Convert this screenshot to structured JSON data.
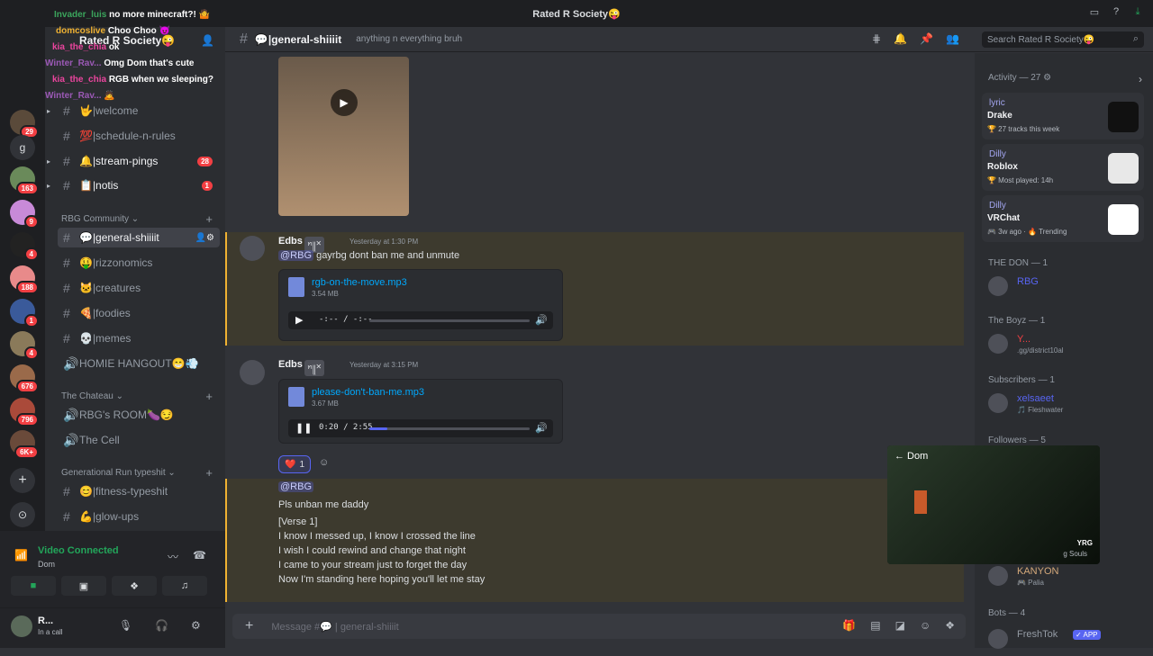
{
  "window": {
    "title": "Rated R Society😜"
  },
  "server": {
    "name": "Rated R Society😜"
  },
  "guild_badges": [
    "29",
    "163",
    "9",
    "4",
    "188",
    "1",
    "4",
    "676",
    "796",
    "6K+"
  ],
  "channels": [
    {
      "name": "🤟|welcome",
      "badge": ""
    },
    {
      "name": "💯|schedule-n-rules",
      "badge": ""
    },
    {
      "name": "🔔|stream-pings",
      "badge": "28"
    },
    {
      "name": "📋|notis",
      "badge": "1"
    }
  ],
  "category_rbg": "RBG Community",
  "channels_rbg": [
    {
      "name": "💬|general-shiiiit",
      "active": true
    },
    {
      "name": "🤑|rizzonomics"
    },
    {
      "name": "🐱|creatures"
    },
    {
      "name": "🍕|foodies"
    },
    {
      "name": "💀|memes"
    },
    {
      "name": "HOMIE HANGOUT😁💨"
    }
  ],
  "category_chateau": "The Chateau",
  "channels_chateau": [
    {
      "name": "RBG's ROOM🍆😏"
    },
    {
      "name": "The Cell"
    }
  ],
  "category_gen": "Generational Run typeshit",
  "channels_gen": [
    {
      "name": "😊|fitness-typeshit"
    },
    {
      "name": "💪|glow-ups"
    }
  ],
  "voice": {
    "status": "Video Connected",
    "channel": "Dom"
  },
  "user": {
    "name": "R...",
    "status": "In a call"
  },
  "header": {
    "channel": "💬|general-shiiiit",
    "topic": "anything n everything bruh",
    "search": "Search Rated R Society😜"
  },
  "messages": [
    {
      "author": "Edbs",
      "tag": "ꪀ꧋✕",
      "time": "Yesterday at 1:30 PM",
      "mention": "@RBG",
      "text": " gayrbg dont ban me and unmute",
      "file": {
        "name": "rgb-on-the-move.mp3",
        "size": "3.54 MB",
        "time": "-:-- / -:--",
        "progress": 0
      }
    },
    {
      "author": "Edbs",
      "tag": "ꪀ꧋✕",
      "time": "Yesterday at 3:15 PM",
      "file": {
        "name": "please-don't-ban-me.mp3",
        "size": "3.67 MB",
        "time": "0:20 / 2:55",
        "progress": 0.11
      },
      "reaction": {
        "emoji": "❤️",
        "count": "1"
      }
    }
  ],
  "reply": {
    "mention": "@RBG",
    "lines": [
      "Pls unban me daddy",
      "[Verse 1]",
      "I know I messed up, I know I crossed the line",
      "I wish I could rewind and change that night",
      "I came to your stream just to forget the day",
      "Now I'm standing here hoping you'll let me stay"
    ]
  },
  "composer": {
    "placeholder": "Message #💬 | general-shiiiit"
  },
  "activity": {
    "title": "Activity — 27 ⚙",
    "items": [
      {
        "user": "lyric",
        "game": "Drake",
        "sub": "🏆 27 tracks this week"
      },
      {
        "user": "Dilly",
        "game": "Roblox",
        "sub": "🏆 Most played: 14h"
      },
      {
        "user": "Dilly",
        "game": "VRChat",
        "sub": "🎮 3w ago · 🔥 Trending"
      }
    ]
  },
  "member_groups": [
    {
      "title": "THE DON — 1",
      "members": [
        {
          "name": "RBG",
          "sub": ""
        }
      ]
    },
    {
      "title": "The Boyz — 1",
      "members": [
        {
          "name": "Y...",
          "sub": ".gg/district10al"
        }
      ]
    },
    {
      "title": "Subscribers — 1",
      "members": [
        {
          "name": "xelsaeet",
          "sub": "🎵 Fleshwater"
        }
      ]
    },
    {
      "title": "Followers — 5",
      "members": [
        {
          "name": "KANYON",
          "sub": "🎮 Palia"
        }
      ]
    },
    {
      "title": "Bots — 4",
      "members": [
        {
          "name": "FreshTok",
          "sub": ""
        }
      ]
    }
  ],
  "bot_tag": "✓ APP",
  "video": {
    "name": "← Dom",
    "overlay_tag": "YRG",
    "overlay_sub": "g Souls"
  },
  "chat_overlay": [
    {
      "user": "Invader_luis",
      "text": "no more minecraft?! 🤷"
    },
    {
      "user": "domcoslive",
      "text": "Choo Choo 😈"
    },
    {
      "user": "kia_the_chia",
      "text": "ok"
    },
    {
      "user": "Winter_Rav...",
      "text": "Omg Dom that's cute"
    },
    {
      "user": "kia_the_chia",
      "text": "RGB when we sleeping?"
    },
    {
      "user": "Winter_Rav...",
      "text": "🙇"
    }
  ],
  "colors": {
    "accent": "#5865f2",
    "mention_bg": "#3d3a2e",
    "online": "#23a55a",
    "badge": "#f23f43"
  }
}
